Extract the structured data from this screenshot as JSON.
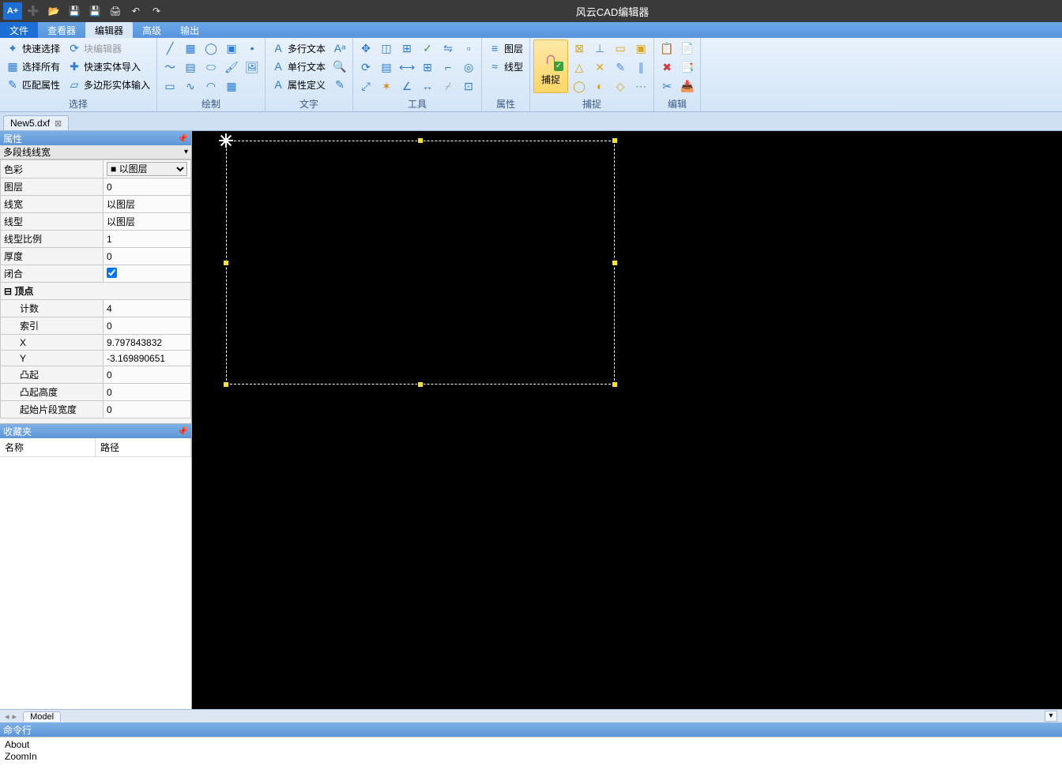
{
  "app": {
    "title": "风云CAD编辑器"
  },
  "qat": [
    {
      "name": "app-icon",
      "glyph": "A+"
    },
    {
      "name": "new-icon",
      "glyph": "➕"
    },
    {
      "name": "open-icon",
      "glyph": "📂"
    },
    {
      "name": "save-icon",
      "glyph": "💾"
    },
    {
      "name": "saveall-icon",
      "glyph": "💾"
    },
    {
      "name": "print-icon",
      "glyph": "🖨"
    },
    {
      "name": "undo-icon",
      "glyph": "↶"
    },
    {
      "name": "redo-icon",
      "glyph": "↷"
    }
  ],
  "menus": [
    {
      "id": "file",
      "label": "文件"
    },
    {
      "id": "viewer",
      "label": "查看器"
    },
    {
      "id": "editor",
      "label": "编辑器"
    },
    {
      "id": "advanced",
      "label": "高级"
    },
    {
      "id": "output",
      "label": "输出"
    }
  ],
  "ribbon": {
    "select": {
      "label": "选择",
      "items": [
        {
          "name": "quick-select",
          "label": "快速选择",
          "glyph": "✦",
          "color": "#2a7bd4"
        },
        {
          "name": "select-all",
          "label": "选择所有",
          "glyph": "▦",
          "color": "#2a7bd4"
        },
        {
          "name": "match-props",
          "label": "匹配属性",
          "glyph": "✎",
          "color": "#2a7bd4"
        },
        {
          "name": "block-edit",
          "label": "块编辑器",
          "glyph": "⟳",
          "disabled": true
        },
        {
          "name": "fast-entity-import",
          "label": "快速实体导入",
          "glyph": "✚"
        },
        {
          "name": "polygon-entity-input",
          "label": "多边形实体输入",
          "glyph": "▱"
        }
      ]
    },
    "draw": {
      "label": "绘制",
      "icons": [
        {
          "name": "line",
          "glyph": "╱",
          "color": "#2a7bd4"
        },
        {
          "name": "polyline",
          "glyph": "〜",
          "color": "#2a7bd4"
        },
        {
          "name": "rect",
          "glyph": "▭",
          "color": "#2a7bd4"
        },
        {
          "name": "hatch",
          "glyph": "▦",
          "color": "#2a7bd4"
        },
        {
          "name": "region",
          "glyph": "▤",
          "color": "#2a7bd4"
        },
        {
          "name": "spline",
          "glyph": "∿",
          "color": "#2a7bd4"
        },
        {
          "name": "circle",
          "glyph": "◯",
          "color": "#2a7bd4"
        },
        {
          "name": "ellipse",
          "glyph": "⬭",
          "color": "#2a7bd4"
        },
        {
          "name": "arc",
          "glyph": "◠",
          "color": "#2a7bd4"
        },
        {
          "name": "block",
          "glyph": "▣",
          "color": "#2a7bd4"
        },
        {
          "name": "paint",
          "glyph": "🖌",
          "color": "#2a7bd4"
        },
        {
          "name": "table",
          "glyph": "▦",
          "color": "#2a7bd4"
        },
        {
          "name": "point",
          "glyph": "•",
          "color": "#2a7bd4"
        },
        {
          "name": "image",
          "glyph": "🖼",
          "color": "#2a7bd4"
        }
      ]
    },
    "text": {
      "label": "文字",
      "items": [
        {
          "name": "mtext",
          "label": "多行文本",
          "glyph": "A",
          "color": "#2a7bd4"
        },
        {
          "name": "dtext",
          "label": "单行文本",
          "glyph": "A",
          "color": "#2a7bd4"
        },
        {
          "name": "attdef",
          "label": "属性定义",
          "glyph": "A",
          "color": "#2a7bd4"
        }
      ],
      "side": [
        {
          "name": "text-style",
          "glyph": "Aᵃ",
          "color": "#2a7bd4"
        },
        {
          "name": "text-find",
          "glyph": "🔍",
          "color": "#2a7bd4"
        },
        {
          "name": "text-edit",
          "glyph": "✎",
          "color": "#2a7bd4"
        }
      ]
    },
    "tools": {
      "label": "工具",
      "icons": [
        {
          "name": "move",
          "glyph": "✥",
          "color": "#2a7bd4"
        },
        {
          "name": "rotate",
          "glyph": "⟳",
          "color": "#2a7bd4"
        },
        {
          "name": "scale",
          "glyph": "⤢",
          "color": "#2a7bd4"
        },
        {
          "name": "select-window",
          "glyph": "◫",
          "color": "#2a7bd4"
        },
        {
          "name": "align",
          "glyph": "▤",
          "color": "#2a7bd4"
        },
        {
          "name": "explode",
          "glyph": "✶",
          "color": "#d08a1e"
        },
        {
          "name": "group",
          "glyph": "⊞",
          "color": "#2a7bd4"
        },
        {
          "name": "dim-linear",
          "glyph": "⟷",
          "color": "#2a7bd4"
        },
        {
          "name": "dim-angle",
          "glyph": "∠",
          "color": "#2a7bd4"
        },
        {
          "name": "erase",
          "glyph": "✓",
          "color": "#3aa03a"
        },
        {
          "name": "array",
          "glyph": "⊞",
          "color": "#2a7bd4"
        },
        {
          "name": "distance",
          "glyph": "↔",
          "color": "#2a7bd4"
        },
        {
          "name": "mirror",
          "glyph": "⇋",
          "color": "#2a7bd4"
        },
        {
          "name": "fillet",
          "glyph": "⌐",
          "color": "#2a7bd4"
        },
        {
          "name": "break",
          "glyph": "⌿",
          "color": "#999"
        },
        {
          "name": "more1",
          "glyph": "▫",
          "color": "#2a7bd4"
        },
        {
          "name": "offset",
          "glyph": "◎",
          "color": "#2a7bd4"
        },
        {
          "name": "more2",
          "glyph": "⊡",
          "color": "#2a7bd4"
        }
      ]
    },
    "props": {
      "label": "属性",
      "items": [
        {
          "name": "layer",
          "label": "图层",
          "glyph": "≡",
          "color": "#2a7bd4"
        },
        {
          "name": "linetype",
          "label": "线型",
          "glyph": "≈",
          "color": "#2a7bd4"
        }
      ]
    },
    "snap": {
      "label": "捕捉",
      "big": {
        "name": "snap",
        "label": "捕捉",
        "glyph": "∩",
        "color": "#d34a9a"
      },
      "grid": [
        {
          "name": "snap-end",
          "glyph": "⊠",
          "color": "#d9a41a"
        },
        {
          "name": "snap-mid",
          "glyph": "△",
          "color": "#d9a41a"
        },
        {
          "name": "snap-cen",
          "glyph": "◯",
          "color": "#d9a41a"
        },
        {
          "name": "snap-per",
          "glyph": "⊥",
          "color": "#4a8de0"
        },
        {
          "name": "snap-int",
          "glyph": "✕",
          "color": "#d9a41a"
        },
        {
          "name": "snap-tan",
          "glyph": "◐",
          "color": "#d9a41a"
        },
        {
          "name": "snap-nea",
          "glyph": "▭",
          "color": "#d9a41a"
        },
        {
          "name": "snap-nod",
          "glyph": "✎",
          "color": "#4a8de0"
        },
        {
          "name": "snap-qua",
          "glyph": "◇",
          "color": "#d9a41a"
        },
        {
          "name": "snap-ins",
          "glyph": "▣",
          "color": "#d9a41a"
        },
        {
          "name": "snap-par",
          "glyph": "∥",
          "color": "#4a8de0"
        },
        {
          "name": "snap-ext",
          "glyph": "⋯",
          "color": "#4a8de0"
        }
      ]
    },
    "edit": {
      "label": "编辑",
      "icons": [
        {
          "name": "copy",
          "glyph": "📋",
          "color": "#2a7bd4"
        },
        {
          "name": "delete",
          "glyph": "✖",
          "color": "#d23a3a"
        },
        {
          "name": "cut",
          "glyph": "✂",
          "color": "#2a7bd4"
        },
        {
          "name": "paste",
          "glyph": "📄",
          "color": "#2a7bd4"
        },
        {
          "name": "copy-clip",
          "glyph": "📑",
          "color": "#2a7bd4"
        },
        {
          "name": "paste-special",
          "glyph": "📥",
          "color": "#2a7bd4"
        }
      ]
    }
  },
  "filetab": {
    "name": "New5.dxf"
  },
  "panels": {
    "properties": {
      "title": "属性",
      "object_type": "多段线线宽",
      "rows": [
        {
          "key": "色彩",
          "type": "select",
          "value": "以图层",
          "swatch": "#000"
        },
        {
          "key": "图层",
          "value": "0"
        },
        {
          "key": "线宽",
          "value": "以图层"
        },
        {
          "key": "线型",
          "value": "以图层"
        },
        {
          "key": "线型比例",
          "value": "1"
        },
        {
          "key": "厚度",
          "value": "0"
        },
        {
          "key": "闭合",
          "type": "check",
          "value": true
        }
      ],
      "group": "顶点",
      "group_rows": [
        {
          "key": "计数",
          "value": "4"
        },
        {
          "key": "索引",
          "value": "0"
        },
        {
          "key": "X",
          "value": "9.797843832"
        },
        {
          "key": "Y",
          "value": "-3.169890651"
        },
        {
          "key": "凸起",
          "value": "0"
        },
        {
          "key": "凸起高度",
          "value": "0"
        },
        {
          "key": "起始片段宽度",
          "value": "0"
        }
      ]
    },
    "favorites": {
      "title": "收藏夹",
      "cols": [
        "名称",
        "路径"
      ]
    }
  },
  "modeltab": "Model",
  "cmd": {
    "title": "命令行",
    "lines": [
      "About",
      "ZoomIn"
    ]
  }
}
